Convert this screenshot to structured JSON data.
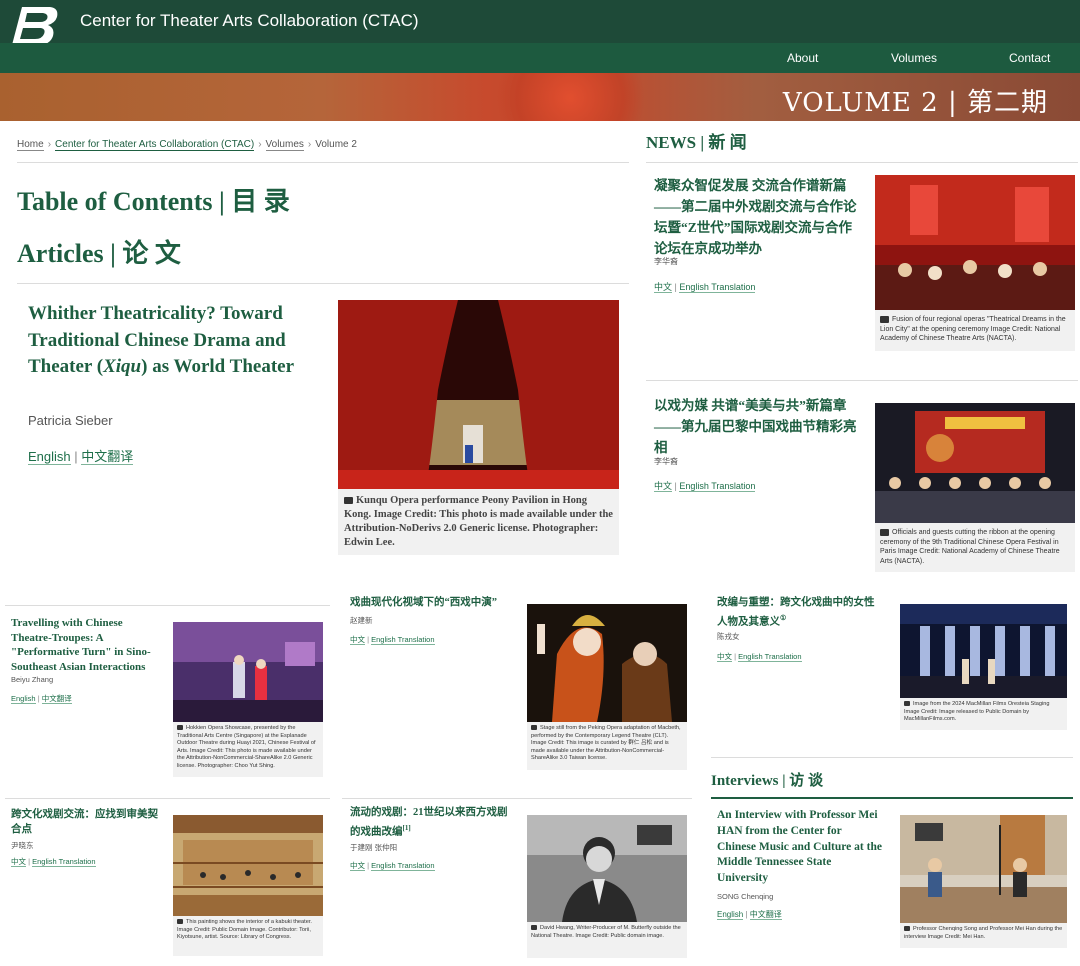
{
  "header": {
    "site_title": "Center for Theater Arts Collaboration (CTAC)",
    "nav": [
      "About",
      "Volumes",
      "Contact"
    ],
    "banner_title": "VOLUME 2 | 第二期"
  },
  "breadcrumb": [
    "Home",
    "Center for Theater Arts Collaboration (CTAC)",
    "Volumes",
    "Volume 2"
  ],
  "toc_heading": "Table of Contents | 目 录",
  "articles_heading": "Articles | 论 文",
  "featured": {
    "title_pre": "Whither Theatricality? Toward Traditional Chinese Drama and Theater (",
    "title_em": "Xiqu",
    "title_post": ") as World Theater",
    "author": "Patricia Sieber",
    "link_en": "English",
    "link_zh": "中文翻译",
    "caption": "Kunqu Opera performance Peony Pavilion in Hong Kong. Image Credit: This photo is made available under the Attribution-NoDerivs 2.0 Generic license. Photographer: Edwin Lee."
  },
  "news": {
    "heading": "NEWS | 新 闻",
    "items": [
      {
        "title": "凝聚众智促发展 交流合作谱新篇——第二届中外戏剧交流与合作论坛暨“Z世代”国际戏剧交流与合作论坛在京成功举办",
        "author": "李华裔",
        "link_zh": "中文",
        "link_en": "English Translation",
        "caption": "Fusion of four regional operas \"Theatrical Dreams in the Lion City\" at the opening ceremony Image Credit: National Academy of Chinese Theatre Arts (NACTA)."
      },
      {
        "title": "以戏为媒 共谱“美美与共”新篇章——第九届巴黎中国戏曲节精彩亮相",
        "author": "李华裔",
        "link_zh": "中文",
        "link_en": "English Translation",
        "caption": "Officials and guests cutting the ribbon at the opening ceremony of the 9th Traditional Chinese Opera Festival in Paris Image Credit: National Academy of Chinese Theatre Arts (NACTA)."
      }
    ]
  },
  "cards": [
    {
      "title": "Travelling with Chinese Theatre-Troupes: A \"Performative Turn\" in Sino-Southeast Asian Interactions",
      "author": "Beiyu Zhang",
      "link_a": "English",
      "link_b": "中文翻译",
      "caption": "Hokkien Opera Showcase, presented by the Traditional Arts Centre (Singapore) at the Esplanade Outdoor Theatre during Huayi 2021, Chinese Festival of Arts. Image Credit: This photo is made available under the Attribution-NonCommercial-ShareAlike 2.0 Generic license. Photographer: Choo Yut Shing."
    },
    {
      "title": "戏曲现代化视域下的“西戏中演”",
      "author": "赵建新",
      "link_a": "中文",
      "link_b": "English Translation",
      "caption": "Stage still from the Peking Opera adaptation of Macbeth, performed by the Contemporary Legend Theatre (CLT). Image Credit: This image is curated by 群仁 吕松 and is made available under the Attribution-NonCommercial-ShareAlike 3.0 Taiwan license."
    },
    {
      "title": "改编与重塑：跨文化戏曲中的女性人物及其意义",
      "sup": "①",
      "author": "陈戎女",
      "link_a": "中文",
      "link_b": "English Translation",
      "caption": "Image from the 2024 MacMillan Films Oresteia Staging Image Credit: Image released to Public Domain by MacMillanFilms.com."
    },
    {
      "title": "跨文化戏剧交流：应找到审美契合点",
      "author": "尹晓东",
      "link_a": "中文",
      "link_b": "English Translation",
      "caption": "This painting shows the interior of a kabuki theater. Image Credit: Public Domain Image. Contributor: Torii, Kiyotsune, artist. Source: Library of Congress."
    },
    {
      "title": "流动的戏剧：21世纪以来西方戏剧的戏曲改编",
      "sup": "[1]",
      "author": "于建刚  张仲阳",
      "link_a": "中文",
      "link_b": "English Translation",
      "caption": "David Hwang, Writer-Producer of M. Butterfly outside the National Theatre. Image Credit: Public domain image."
    }
  ],
  "interviews": {
    "heading": "Interviews | 访 谈",
    "item": {
      "title": "An Interview with Professor Mei HAN from the Center for Chinese Music and Culture at the Middle Tennessee State University",
      "author": "SONG Chenqing",
      "link_a": "English",
      "link_b": "中文翻译",
      "caption": "Professor Chenqing Song and Professor Mei Han during the interview Image Credit: Mei Han."
    }
  }
}
